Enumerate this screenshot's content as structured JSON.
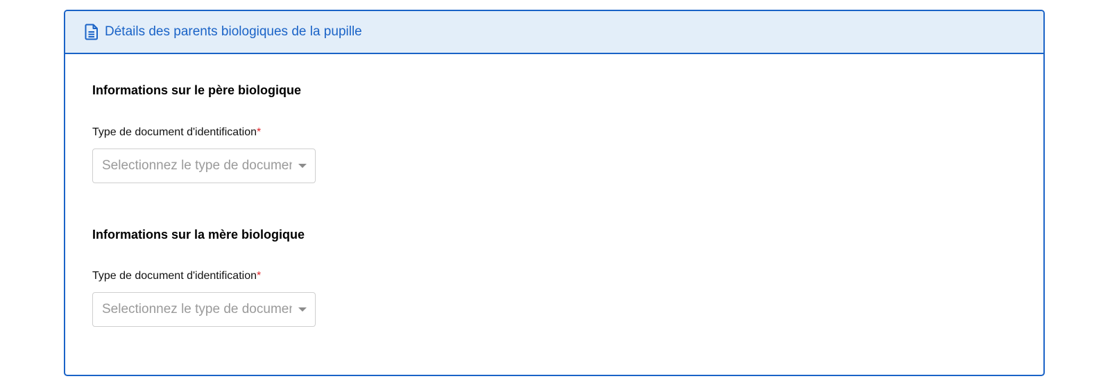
{
  "card": {
    "title": "Détails des parents biologiques de la pupille",
    "icon": "document-icon"
  },
  "father": {
    "section_title": "Informations sur le père biologique",
    "doc_type_label": "Type de document d'identification",
    "required_mark": "*",
    "doc_type_placeholder": "Selectionnez le type de document"
  },
  "mother": {
    "section_title": "Informations sur la mère biologique",
    "doc_type_label": "Type de document d'identification",
    "required_mark": "*",
    "doc_type_placeholder": "Selectionnez le type de document"
  },
  "colors": {
    "accent": "#1a63c7",
    "header_bg": "#e3eef9",
    "required": "#e0262b"
  }
}
